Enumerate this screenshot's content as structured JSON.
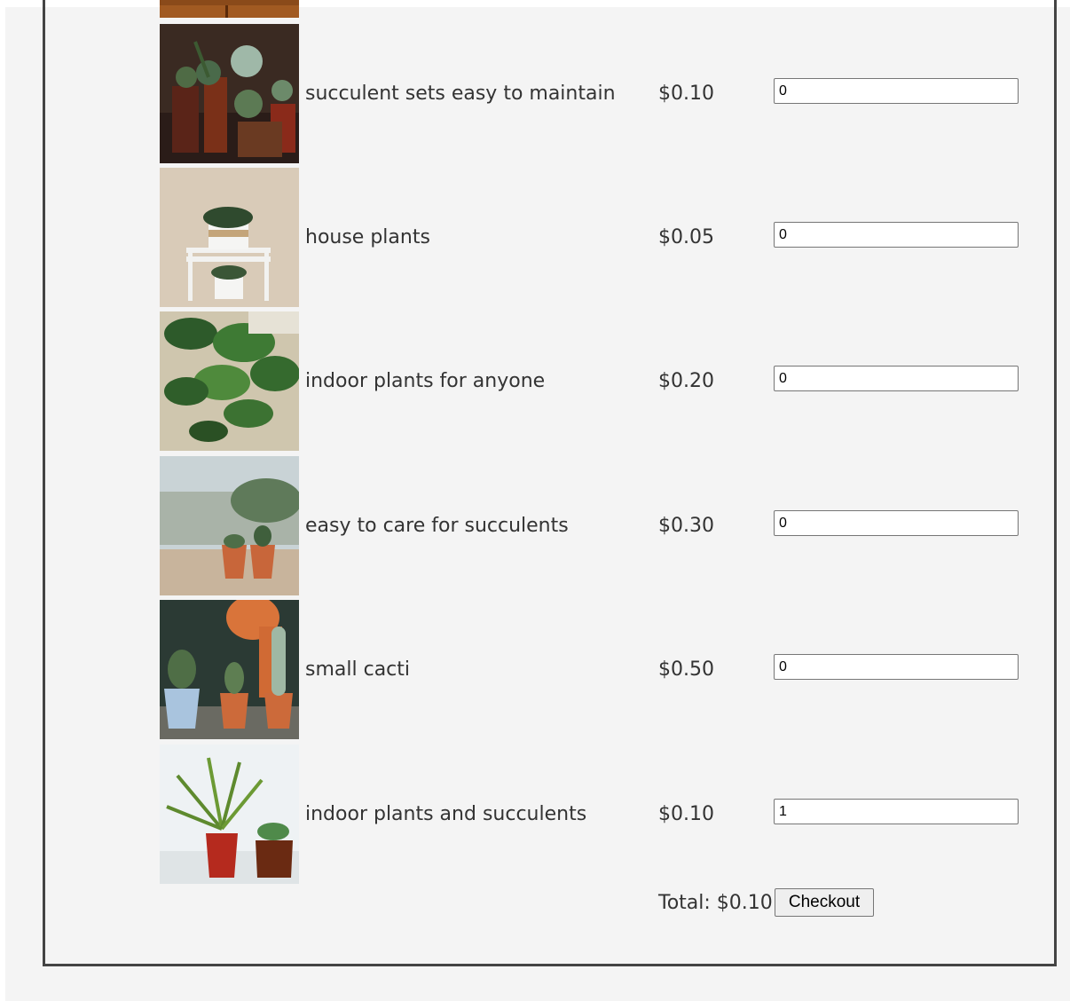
{
  "products": [
    {
      "name": "succulent sets easy to maintain",
      "price": "$0.10",
      "quantity": "0",
      "image": "succulent-set-photo"
    },
    {
      "name": "house plants",
      "price": "$0.05",
      "quantity": "0",
      "image": "house-plants-photo"
    },
    {
      "name": "indoor plants for anyone",
      "price": "$0.20",
      "quantity": "0",
      "image": "indoor-plants-photo"
    },
    {
      "name": "easy to care for succulents",
      "price": "$0.30",
      "quantity": "0",
      "image": "succulent-pots-photo"
    },
    {
      "name": "small cacti",
      "price": "$0.50",
      "quantity": "0",
      "image": "small-cacti-photo"
    },
    {
      "name": "indoor plants and succulents",
      "price": "$0.10",
      "quantity": "1",
      "image": "window-plants-photo"
    }
  ],
  "cart": {
    "total_label": "Total: $0.10",
    "checkout_label": "Checkout"
  }
}
